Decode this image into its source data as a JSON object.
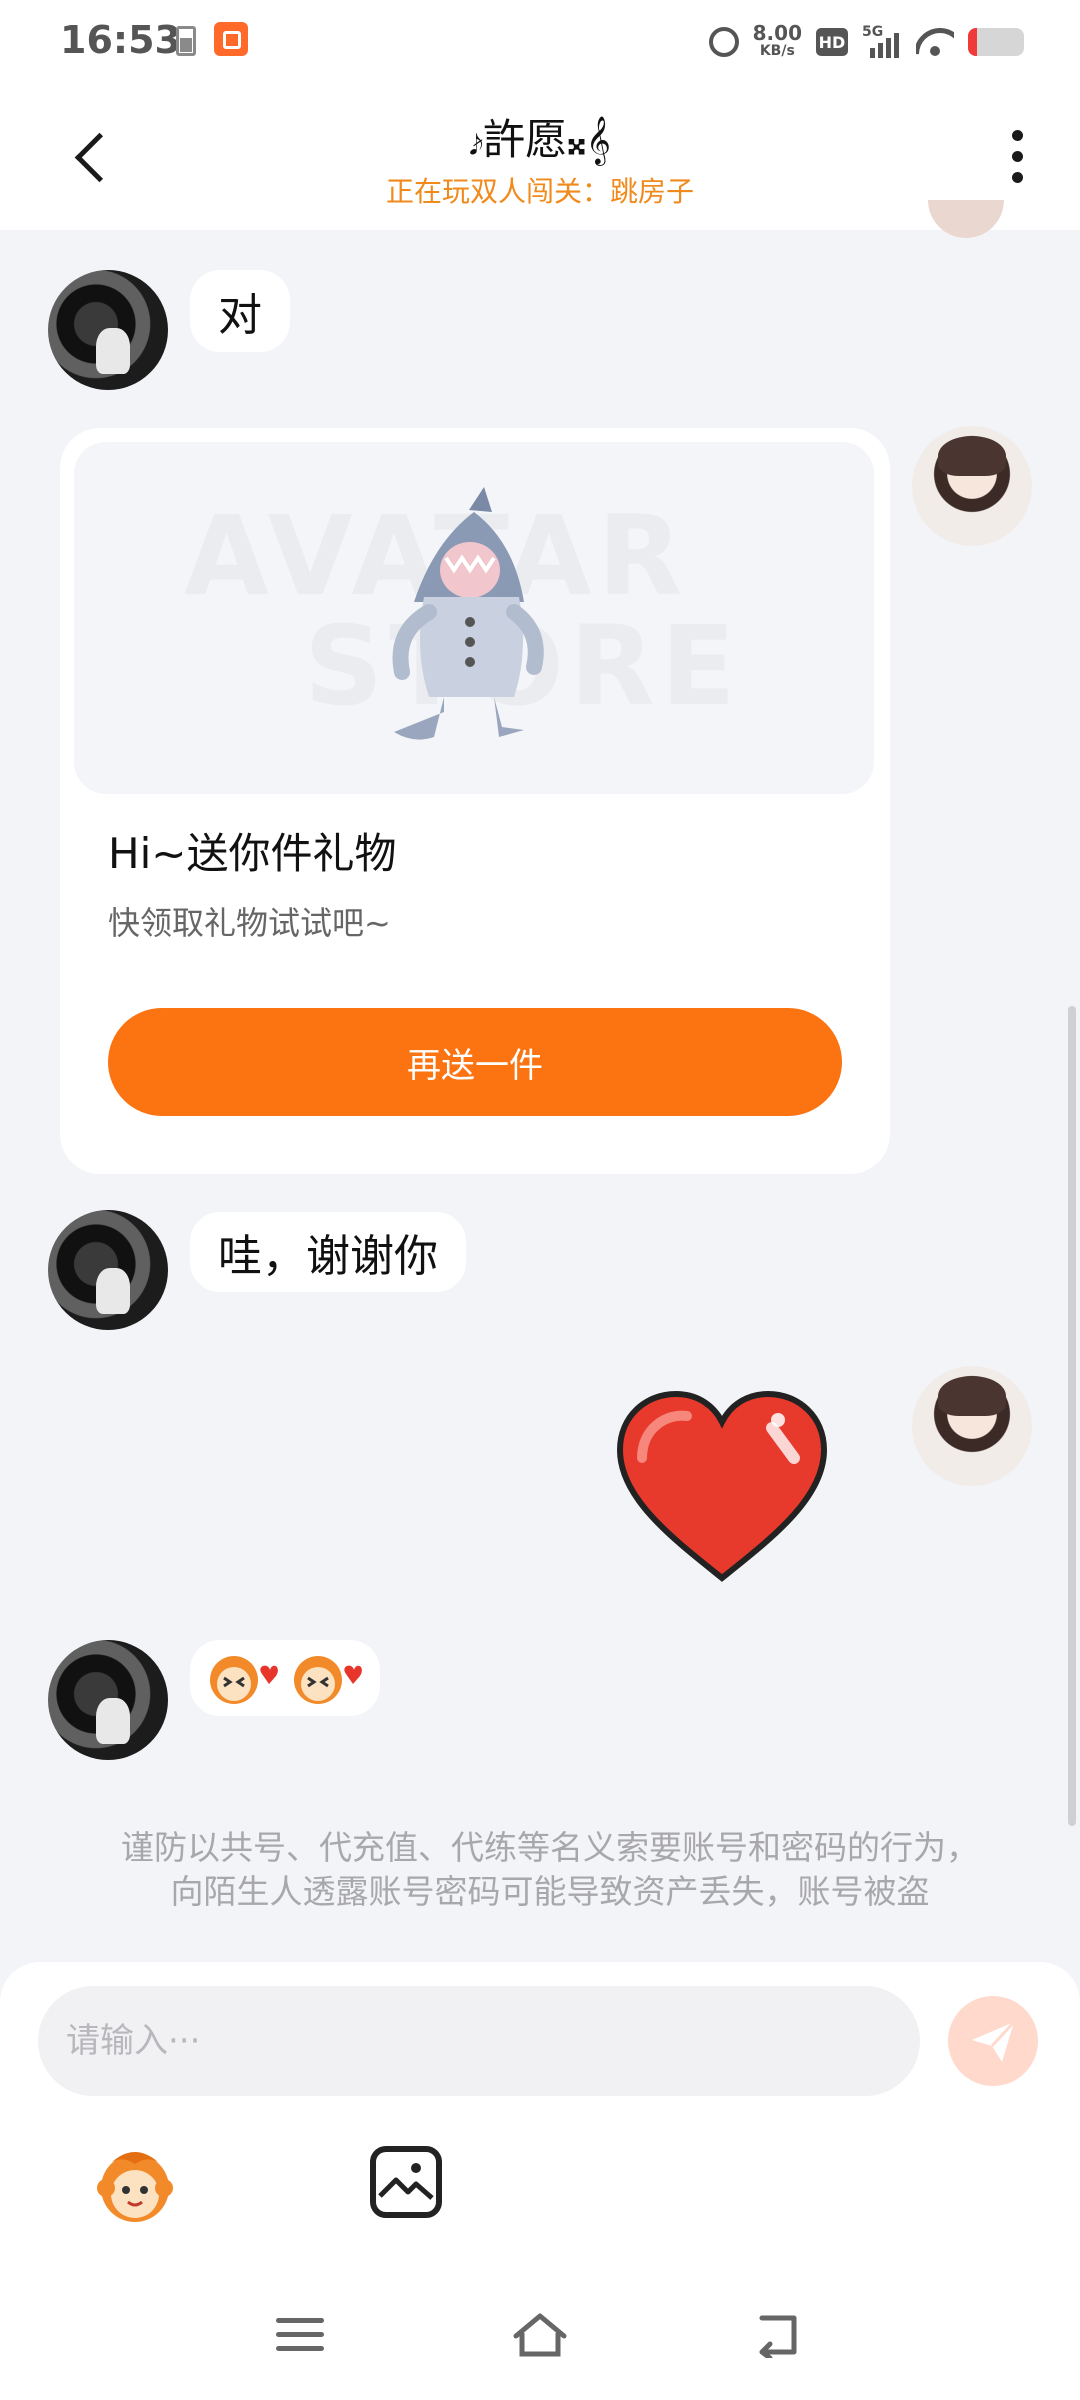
{
  "status_bar": {
    "time": "16:53",
    "net_speed_value": "8.00",
    "net_speed_unit": "KB/s",
    "hd": "HD",
    "network": "5G"
  },
  "header": {
    "title": "𝆔許愿𝄪𝄞",
    "subtitle": "正在玩双人闯关：跳房子"
  },
  "messages": {
    "m1": "对",
    "gift_title": "Hi~送你件礼物",
    "gift_desc": "快领取礼物试试吧~",
    "gift_button": "再送一件",
    "gift_watermark_1": "AVATAR",
    "gift_watermark_2": "STORE",
    "m3": "哇，谢谢你"
  },
  "warning": {
    "line1": "谨防以共号、代充值、代练等名义索要账号和密码的行为，",
    "line2": "向陌生人透露账号密码可能导致资产丢失，账号被盗"
  },
  "input": {
    "placeholder": "请输入···"
  },
  "icons": {
    "back": "back-arrow-icon",
    "more": "more-vertical-icon",
    "send": "send-icon",
    "emoji": "emoji-icon",
    "image": "image-icon"
  },
  "colors": {
    "accent": "#fc7312",
    "subtitle": "#f08a1c",
    "background": "#f3f4f8"
  }
}
